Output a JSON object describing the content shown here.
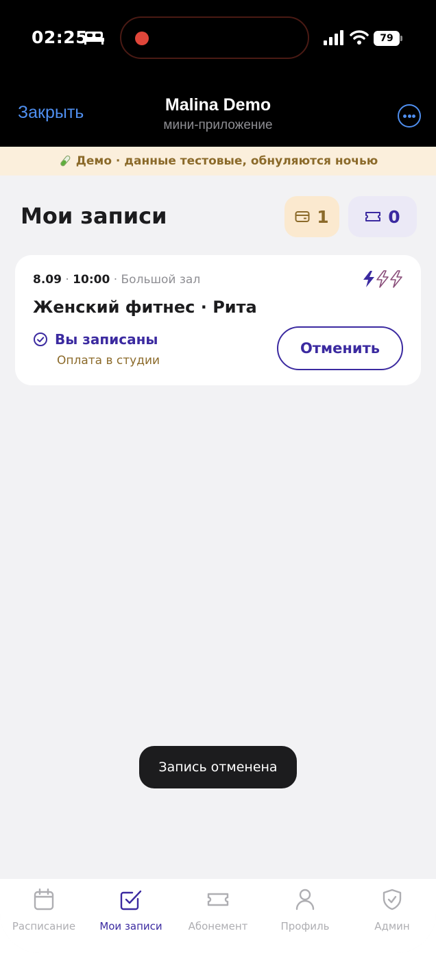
{
  "status_bar": {
    "time": "02:25",
    "battery": "79",
    "icons": [
      "bed-icon",
      "signal-icon",
      "wifi-icon",
      "battery-icon"
    ]
  },
  "header": {
    "close_label": "Закрыть",
    "title": "Malina Demo",
    "subtitle": "мини-приложение",
    "more_icon": "ellipsis-circle-icon"
  },
  "banner": {
    "text": "Демо · данные тестовые, обнуляются ночью",
    "icon": "test-tube-icon"
  },
  "page": {
    "title": "Мои записи",
    "wallet_count": "1",
    "ticket_count": "0"
  },
  "booking": {
    "date": "8.09",
    "separator": " · ",
    "time": "10:00",
    "hall": "Большой зал",
    "title": "Женский фитнес · Рита",
    "intensity_level": 1,
    "intensity_max": 3,
    "status": "Вы записаны",
    "payment": "Оплата в студии",
    "cancel_label": "Отменить"
  },
  "toast": {
    "text": "Запись отменена"
  },
  "tabbar": {
    "tabs": [
      {
        "label": "Расписание",
        "icon": "calendar-icon",
        "active": false
      },
      {
        "label": "Мои записи",
        "icon": "checkbox-icon",
        "active": true
      },
      {
        "label": "Абонемент",
        "icon": "ticket-icon",
        "active": false
      },
      {
        "label": "Профиль",
        "icon": "person-icon",
        "active": false
      },
      {
        "label": "Админ",
        "icon": "shield-icon",
        "active": false
      }
    ]
  },
  "colors": {
    "accent": "#3b2aa0",
    "link": "#4f8ff0",
    "gold": "#8b6a2a",
    "banner_bg": "#fbefdc"
  }
}
